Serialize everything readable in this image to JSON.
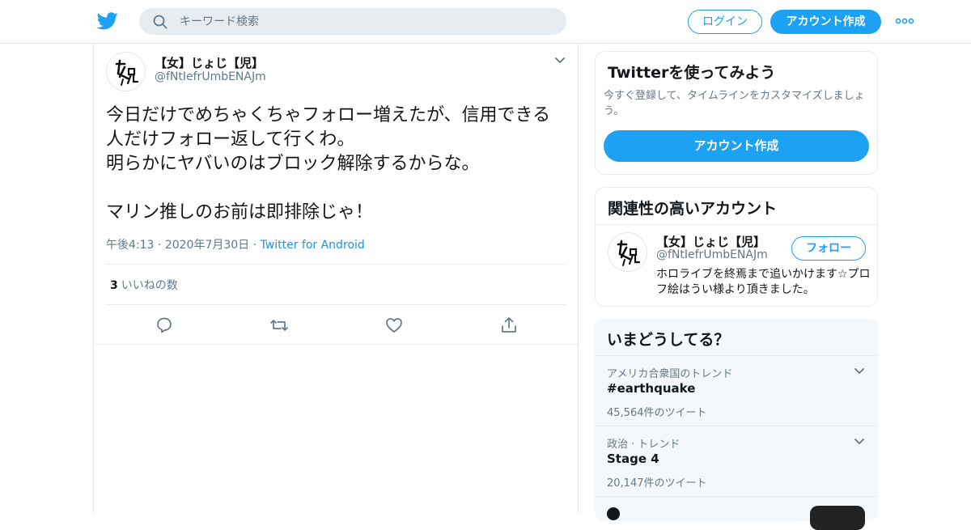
{
  "header": {
    "logo": "twitter-bird-icon",
    "search_placeholder": "キーワード検索",
    "login_label": "ログイン",
    "signup_label": "アカウント作成",
    "more_icon": "more-dots-icon",
    "accent_color": "#1da1f2"
  },
  "tweet": {
    "author_name": "【女】じょじ【児】",
    "author_handle": "@fNtIefrUmbENAJm",
    "text": "今日だけでめちゃくちゃフォロー増えたが、信用できる人だけフォロー返して行くわ。\n明らかにヤバいのはブロック解除するからな。\n\nマリン推しのお前は即排除じゃ！",
    "time": "午後4:13",
    "date": "2020年7月30日",
    "source": "Twitter for Android",
    "like_count": "3",
    "like_label": "いいねの数",
    "actions": [
      "reply-icon",
      "retweet-icon",
      "like-icon",
      "share-icon"
    ]
  },
  "signup_card": {
    "title": "Twitterを使ってみよう",
    "description": "今すぐ登録して、タイムラインをカスタマイズしましょう。",
    "button_label": "アカウント作成"
  },
  "related": {
    "title": "関連性の高いアカウント",
    "name": "【女】じょじ【児】",
    "handle": "@fNtIefrUmbENAJm",
    "follow_label": "フォロー",
    "bio": "ホロライブを終焉まで追いかけます☆プロフ絵はうい様より頂きました。"
  },
  "trends": {
    "title": "いまどうしてる？",
    "items": [
      {
        "context": "アメリカ合衆国のトレンド",
        "name": "#earthquake",
        "count": "45,564件のツイート"
      },
      {
        "context": "政治 · トレンド",
        "name": "Stage 4",
        "count": "20,147件のツイート"
      }
    ]
  }
}
